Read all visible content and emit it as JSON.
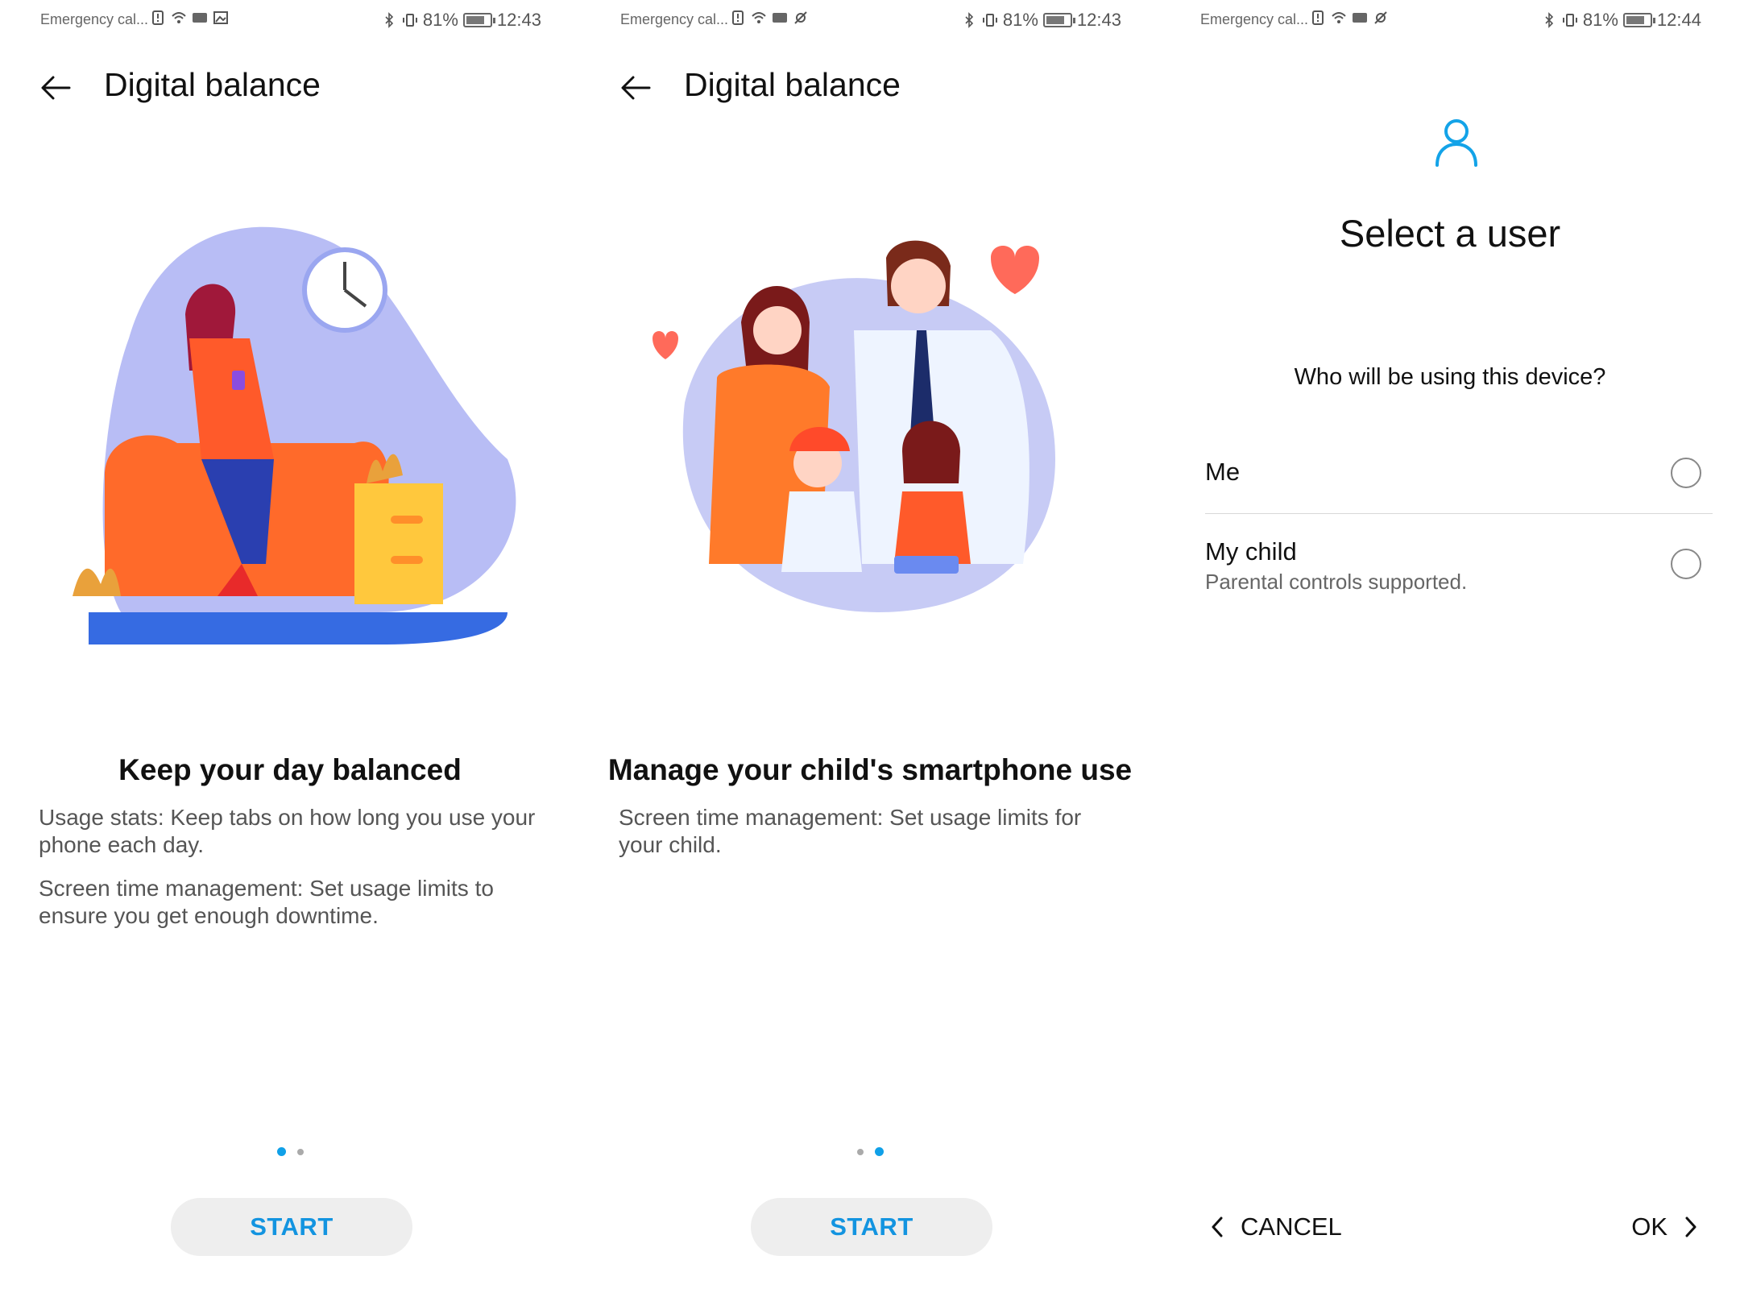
{
  "colors": {
    "accent": "#1394e0",
    "dot_active": "#10a0e8",
    "text": "#111111",
    "muted": "#555555"
  },
  "screens": [
    {
      "status": {
        "carrier": "Emergency cal...",
        "battery": "81%",
        "time": "12:43",
        "battery_level": 0.81
      },
      "title": "Digital balance",
      "headline": "Keep your day balanced",
      "descriptions": [
        "Usage stats: Keep tabs on how long you use your phone each day.",
        "Screen time management: Set usage limits to ensure you get enough downtime."
      ],
      "page_indicator": {
        "count": 2,
        "active": 1
      },
      "start_label": "START",
      "illustration": "woman-on-sofa-with-phone"
    },
    {
      "status": {
        "carrier": "Emergency cal...",
        "battery": "81%",
        "time": "12:43",
        "battery_level": 0.81
      },
      "title": "Digital balance",
      "headline": "Manage your child's smartphone use",
      "descriptions": [
        "Screen time management: Set usage limits for your child."
      ],
      "page_indicator": {
        "count": 2,
        "active": 2
      },
      "start_label": "START",
      "illustration": "family-with-devices"
    },
    {
      "status": {
        "carrier": "Emergency cal...",
        "battery": "81%",
        "time": "12:44",
        "battery_level": 0.81
      },
      "title": "Select a user",
      "question": "Who will be using this device?",
      "options": [
        {
          "label": "Me",
          "selected": false
        },
        {
          "label": "My child",
          "sublabel": "Parental controls supported.",
          "selected": false
        }
      ],
      "cancel_label": "CANCEL",
      "ok_label": "OK"
    }
  ]
}
